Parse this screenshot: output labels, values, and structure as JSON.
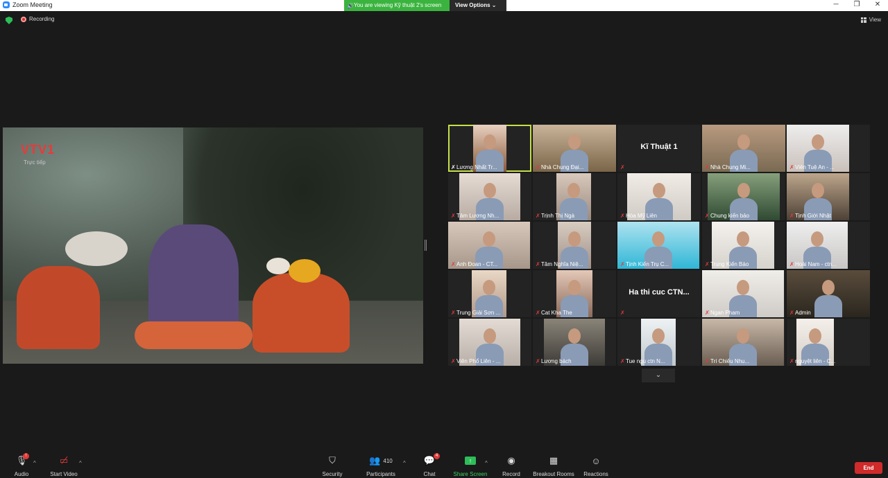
{
  "window": {
    "title": "Zoom Meeting"
  },
  "viewing_banner": {
    "text": "You are viewing Kỹ thuật 2's screen",
    "options_label": "View Options"
  },
  "top": {
    "recording_label": "Recording",
    "view_label": "View"
  },
  "shared_screen": {
    "logo": "VTV1",
    "sublabel": "Trực tiếp"
  },
  "participants": [
    {
      "name": "Lương Nhất Tr...",
      "active": true
    },
    {
      "name": "Nhà Chung Đại..."
    },
    {
      "name": "",
      "display": "Kĩ Thuật 1"
    },
    {
      "name": "Nhà Chung Mi..."
    },
    {
      "name": "Viên Tuệ An - ..."
    },
    {
      "name": "Tâm Lương Nh..."
    },
    {
      "name": "Trịnh Thị Ngà"
    },
    {
      "name": "Hòa Mỹ Liên"
    },
    {
      "name": "Chung kiến bảo"
    },
    {
      "name": "Tịnh Giới Nhật"
    },
    {
      "name": "Anh Đoan - CT..."
    },
    {
      "name": "Tâm Nghĩa Niệ..."
    },
    {
      "name": "Tịnh Kiến Trụ C..."
    },
    {
      "name": "Trung Kiến Bảo"
    },
    {
      "name": "Hoài Nam - ctn..."
    },
    {
      "name": "Trung Giải Sơn ..."
    },
    {
      "name": "Cat Kha The"
    },
    {
      "name": "",
      "display": "Ha thi cuc CTN..."
    },
    {
      "name": "Ngan Pham"
    },
    {
      "name": "Admin"
    },
    {
      "name": "Viên Phổ Liên - ..."
    },
    {
      "name": "Lương bách"
    },
    {
      "name": "Tue ngu ctn N..."
    },
    {
      "name": "Trí Chiếu Nhu..."
    },
    {
      "name": "nguyệt liên - C..."
    }
  ],
  "toolbar": {
    "audio": "Audio",
    "start_video": "Start Video",
    "security": "Security",
    "participants": "Participants",
    "participants_count": "410",
    "chat": "Chat",
    "chat_badge": "4",
    "share_screen": "Share Screen",
    "record": "Record",
    "breakout": "Breakout Rooms",
    "reactions": "Reactions",
    "end": "End"
  }
}
